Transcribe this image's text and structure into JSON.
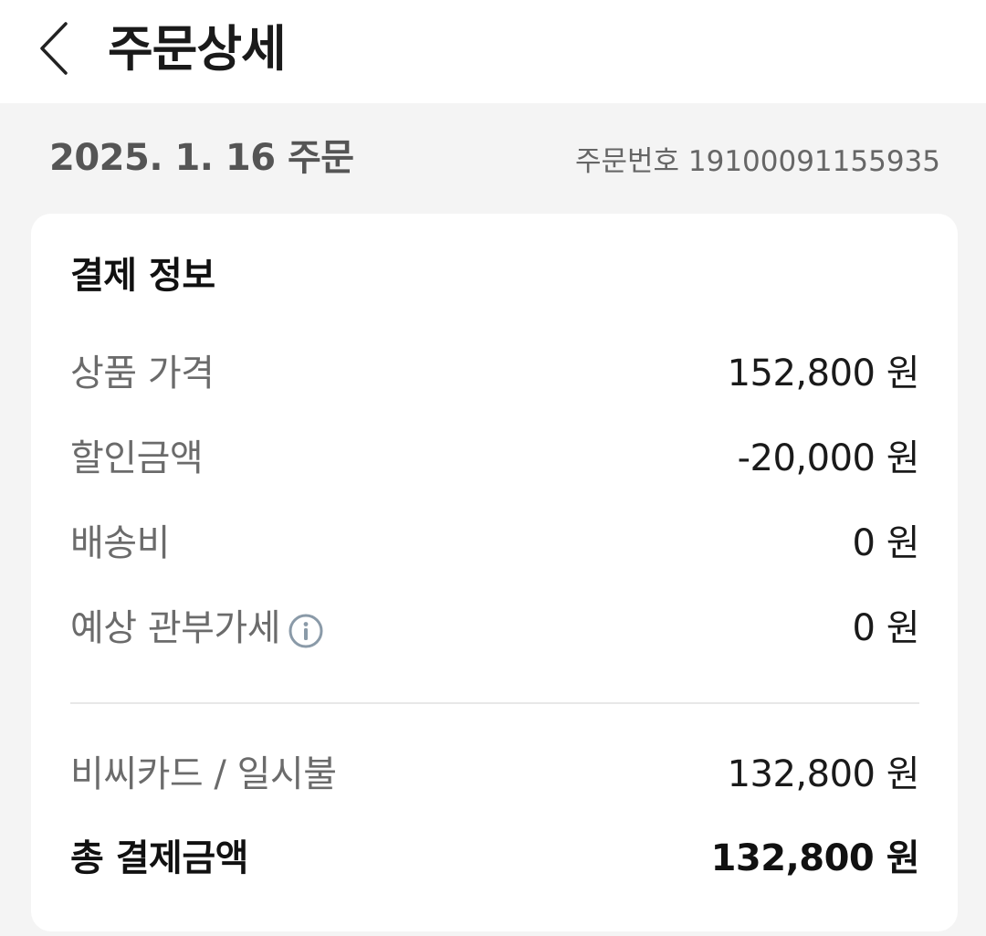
{
  "header": {
    "title": "주문상세",
    "back_icon": "chevron-left-icon"
  },
  "order": {
    "date_label": "2025. 1. 16 주문",
    "number_label": "주문번호 19100091155935"
  },
  "payment": {
    "title": "결제 정보",
    "rows": [
      {
        "label": "상품 가격",
        "value": "152,800 원"
      },
      {
        "label": "할인금액",
        "value": "-20,000 원"
      },
      {
        "label": "배송비",
        "value": "0 원"
      },
      {
        "label": "예상 관부가세",
        "value": "0 원",
        "icon": "info-icon"
      }
    ],
    "method": {
      "label": "비씨카드 / 일시불",
      "value": "132,800 원"
    },
    "total": {
      "label": "총 결제금액",
      "value": "132,800 원"
    }
  },
  "colors": {
    "background": "#f4f4f4",
    "card": "#ffffff",
    "label_gray": "#6b6b6b",
    "text_dark": "#1a1a1a",
    "info_icon": "#8a9aa8"
  }
}
